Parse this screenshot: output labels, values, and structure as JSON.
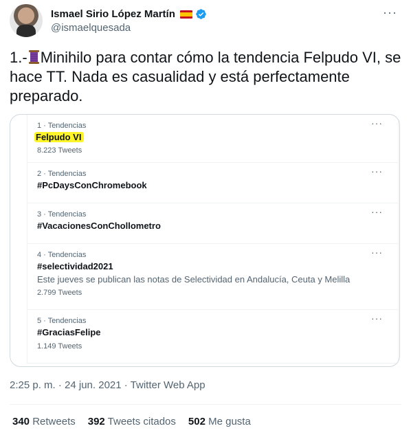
{
  "author": {
    "name": "Ismael Sirio López Martín",
    "handle": "@ismaelquesada",
    "flag_icon": "spain-flag-icon",
    "verified_icon": "verified-badge-icon",
    "verified_color": "#1d9bf0"
  },
  "tweet": {
    "text_prefix": "1.-",
    "text_emoji": "thread-spool-icon",
    "text_body": "Minihilo para contar cómo la tendencia Felpudo VI, se hace TT. Nada es casualidad y está perfectamente preparado."
  },
  "embedded_trends": [
    {
      "meta": "1 · Tendencias",
      "title": "Felpudo VI",
      "description": "",
      "count": "8.223 Tweets",
      "highlighted": true
    },
    {
      "meta": "2 · Tendencias",
      "title": "#PcDaysConChromebook",
      "description": "",
      "count": ""
    },
    {
      "meta": "3 · Tendencias",
      "title": "#VacacionesConChollometro",
      "description": "",
      "count": ""
    },
    {
      "meta": "4 · Tendencias",
      "title": "#selectividad2021",
      "description": "Este jueves se publican las notas de Selectividad en Andalucía, Ceuta y Melilla",
      "count": "2.799 Tweets"
    },
    {
      "meta": "5 · Tendencias",
      "title": "#GraciasFelipe",
      "description": "",
      "count": "1.149 Tweets"
    }
  ],
  "footer": {
    "timestamp": "2:25 p. m. · 24 jun. 2021 · Twitter Web App",
    "retweets_count": "340",
    "retweets_label": "Retweets",
    "quotes_count": "392",
    "quotes_label": "Tweets citados",
    "likes_count": "502",
    "likes_label": "Me gusta"
  },
  "colors": {
    "highlight": "#fdf52a",
    "secondary_text": "#536471"
  }
}
